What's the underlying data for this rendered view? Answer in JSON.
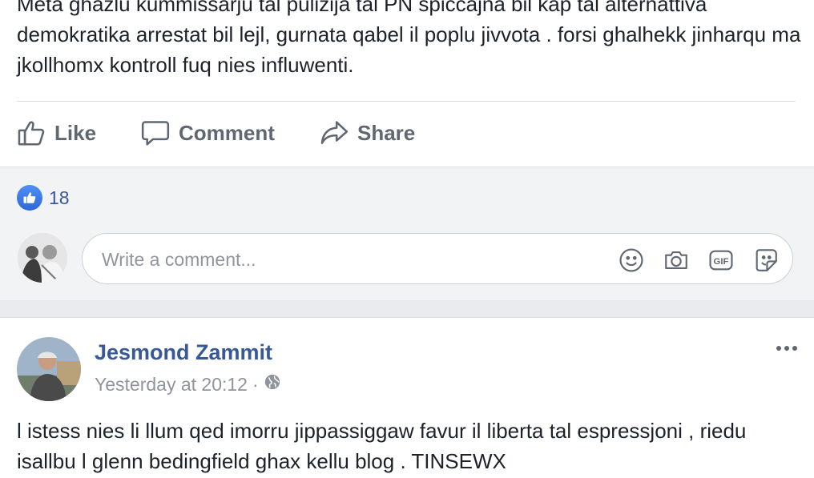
{
  "post1": {
    "text": "Meta għażlu kummissarju tal pulizija tal PN spiċċajna bil kap tal alternattiva demokratika arrestat bil lejl, gurnata qabel il poplu jivvota . forsi ghalhekk jinharqu ma jkollhomx kontroll fuq nies influwenti.",
    "actions": {
      "like": "Like",
      "comment": "Comment",
      "share": "Share"
    },
    "reactions": {
      "count": "18",
      "icon": "like-reaction-icon"
    },
    "comment_box": {
      "placeholder": "Write a comment..."
    }
  },
  "post2": {
    "author": "Jesmond Zammit",
    "timestamp": "Yesterday at 20:12",
    "separator": "·",
    "privacy_icon": "globe-icon",
    "more_icon": "more-options-icon",
    "text": "l istess nies li llum qed imorru jippassiggaw favur il liberta tal espressjoni , riedu isallbu l glenn bedingfield ghax kellu blog . TINSEWX"
  },
  "colors": {
    "link": "#385898",
    "action_gray": "#606770",
    "meta_gray": "#90949c",
    "like_blue": "#2d68d9",
    "page_bg": "#e9ebee"
  }
}
